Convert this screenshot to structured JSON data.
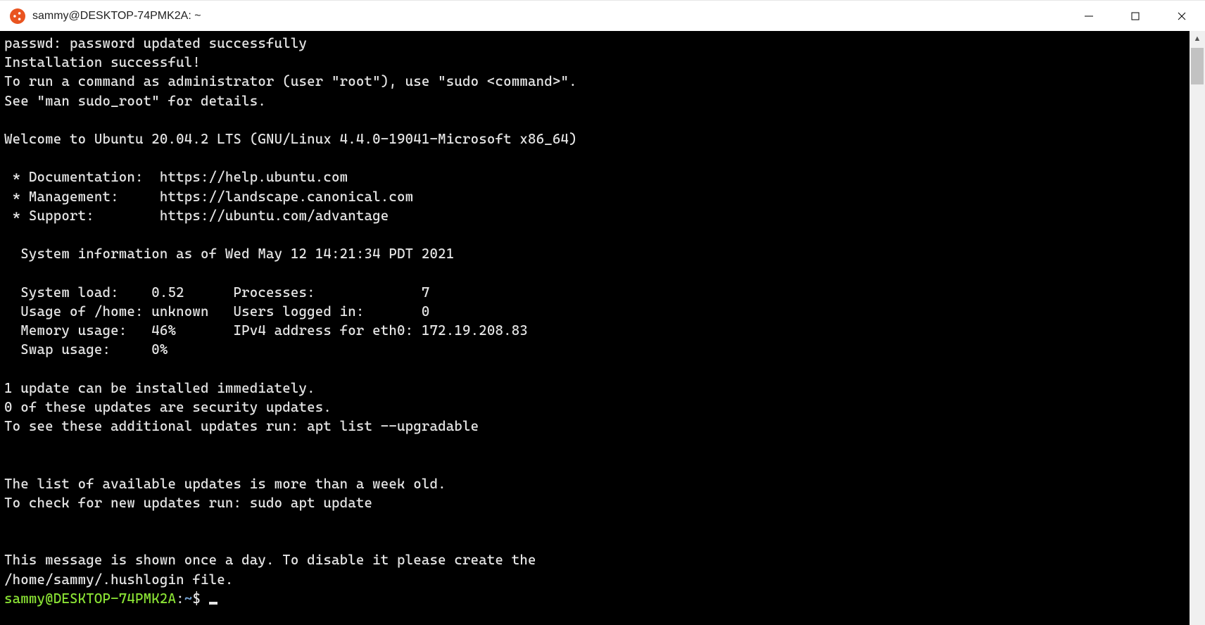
{
  "titlebar": {
    "app_icon": "ubuntu-icon",
    "title": "sammy@DESKTOP-74PMK2A: ~",
    "buttons": {
      "minimize": "minimize",
      "maximize": "maximize",
      "close": "close"
    }
  },
  "terminal": {
    "lines": [
      "passwd: password updated successfully",
      "Installation successful!",
      "To run a command as administrator (user \"root\"), use \"sudo <command>\".",
      "See \"man sudo_root\" for details.",
      "",
      "Welcome to Ubuntu 20.04.2 LTS (GNU/Linux 4.4.0-19041-Microsoft x86_64)",
      "",
      " * Documentation:  https://help.ubuntu.com",
      " * Management:     https://landscape.canonical.com",
      " * Support:        https://ubuntu.com/advantage",
      "",
      "  System information as of Wed May 12 14:21:34 PDT 2021",
      "",
      "  System load:    0.52      Processes:             7",
      "  Usage of /home: unknown   Users logged in:       0",
      "  Memory usage:   46%       IPv4 address for eth0: 172.19.208.83",
      "  Swap usage:     0%",
      "",
      "1 update can be installed immediately.",
      "0 of these updates are security updates.",
      "To see these additional updates run: apt list --upgradable",
      "",
      "",
      "The list of available updates is more than a week old.",
      "To check for new updates run: sudo apt update",
      "",
      "",
      "This message is shown once a day. To disable it please create the",
      "/home/sammy/.hushlogin file."
    ],
    "prompt": {
      "user_host": "sammy@DESKTOP-74PMK2A",
      "sep": ":",
      "path": "~",
      "symbol": "$"
    }
  }
}
